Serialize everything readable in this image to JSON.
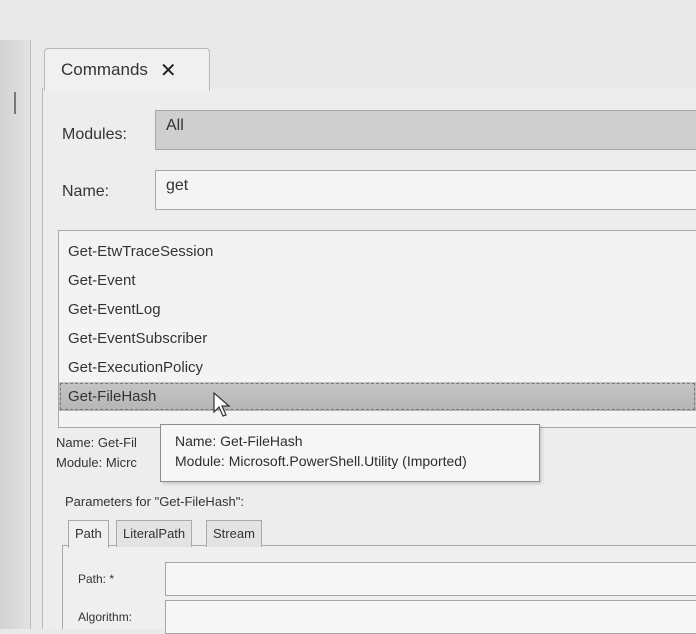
{
  "tab": {
    "title": "Commands",
    "close_icon": "✕"
  },
  "modules": {
    "label": "Modules:",
    "value": "All"
  },
  "name": {
    "label": "Name:",
    "value": "get"
  },
  "commands": [
    "Get-EtwTraceSession",
    "Get-Event",
    "Get-EventLog",
    "Get-EventSubscriber",
    "Get-ExecutionPolicy",
    "Get-FileHash"
  ],
  "selected_index": 5,
  "details": {
    "name_line": "Name: Get-Fil",
    "module_line": "Module: Micrc"
  },
  "tooltip": {
    "name_line": "Name: Get-FileHash",
    "module_line": "Module: Microsoft.PowerShell.Utility (Imported)"
  },
  "parameters": {
    "title": "Parameters for \"Get-FileHash\":",
    "tabs": [
      "Path",
      "LiteralPath",
      "Stream"
    ],
    "active_tab": "Path",
    "fields": [
      {
        "label": "Path: *",
        "value": ""
      },
      {
        "label": "Algorithm:",
        "value": ""
      }
    ]
  },
  "colors": {
    "selected_row": "#bdbdbd",
    "panel_bg": "#ededed"
  }
}
